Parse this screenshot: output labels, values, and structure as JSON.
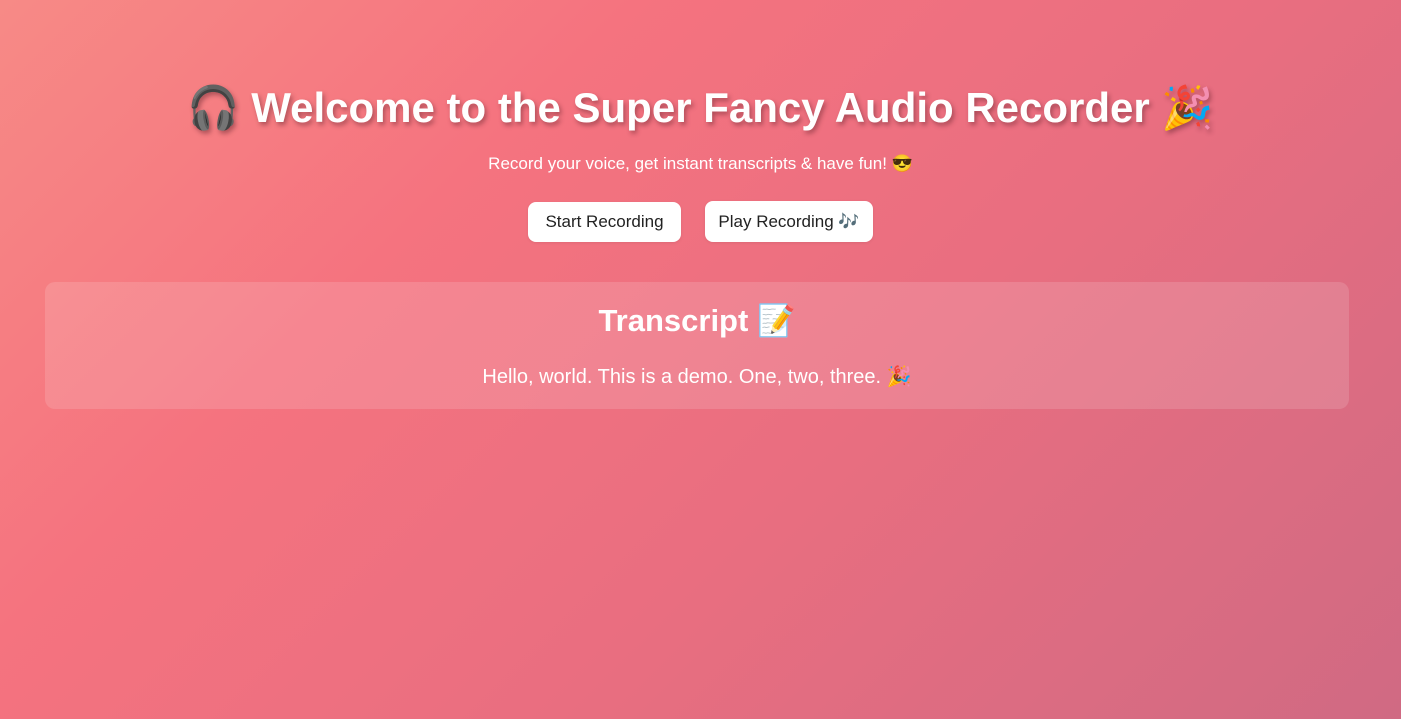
{
  "header": {
    "icon_left": "🎧",
    "icon_left_name": "headphones-icon",
    "title": "Welcome to the Super Fancy Audio Recorder",
    "icon_right": "🎉",
    "icon_right_name": "party-popper-icon",
    "subtitle": "Record your voice, get instant transcripts & have fun! 😎"
  },
  "controls": {
    "start_label": "Start Recording",
    "play_label": "Play Recording 🎶"
  },
  "transcript": {
    "heading": "Transcript",
    "heading_icon": "📝",
    "heading_icon_name": "memo-icon",
    "text": "Hello, world. This is a demo. One, two, three. 🎉"
  },
  "colors": {
    "background_start": "#f78a86",
    "background_end": "#d06a83",
    "button_bg": "#ffffff",
    "button_text": "#222222"
  }
}
